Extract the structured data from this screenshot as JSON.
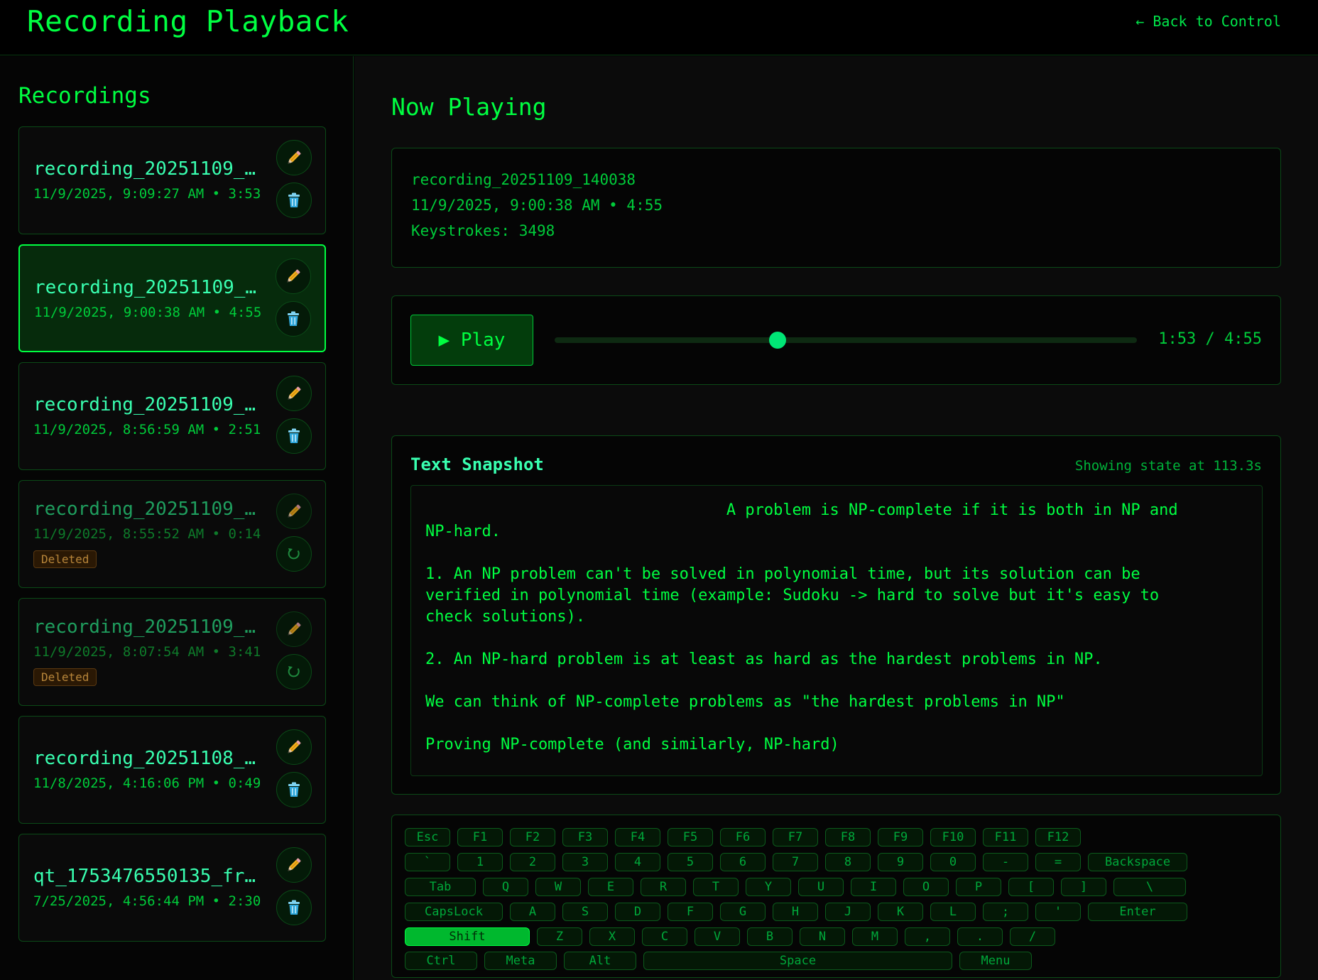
{
  "header": {
    "title": "Recording Playback",
    "back_label": "← Back to Control"
  },
  "sidebar": {
    "heading": "Recordings",
    "recordings": [
      {
        "name": "recording_20251109_…",
        "meta": "11/9/2025, 9:09:27 AM • 3:53",
        "state": "normal"
      },
      {
        "name": "recording_20251109_…",
        "meta": "11/9/2025, 9:00:38 AM • 4:55",
        "state": "active"
      },
      {
        "name": "recording_20251109_…",
        "meta": "11/9/2025, 8:56:59 AM • 2:51",
        "state": "normal"
      },
      {
        "name": "recording_20251109_…",
        "meta": "11/9/2025, 8:55:52 AM • 0:14",
        "state": "deleted",
        "badge": "Deleted"
      },
      {
        "name": "recording_20251109_…",
        "meta": "11/9/2025, 8:07:54 AM • 3:41",
        "state": "deleted",
        "badge": "Deleted"
      },
      {
        "name": "recording_20251108_…",
        "meta": "11/8/2025, 4:16:06 PM • 0:49",
        "state": "normal"
      },
      {
        "name": "qt_1753476550135_fr…",
        "meta": "7/25/2025, 4:56:44 PM • 2:30",
        "state": "normal"
      }
    ],
    "icons": {
      "edit": "pencil-icon",
      "delete": "trash-icon",
      "restore": "restore-icon"
    }
  },
  "main": {
    "heading": "Now Playing",
    "info": {
      "name": "recording_20251109_140038",
      "meta": "11/9/2025, 9:00:38 AM • 4:55",
      "keystrokes": "Keystrokes: 3498"
    },
    "player": {
      "play_label": "▶ Play",
      "time": "1:53 / 4:55",
      "progress": 0.383
    },
    "snapshot": {
      "title": "Text Snapshot",
      "state": "Showing state at 113.3s",
      "text": "                                A problem is NP-complete if it is both in NP and\nNP-hard.\n\n1. An NP problem can't be solved in polynomial time, but its solution can be\nverified in polynomial time (example: Sudoku -> hard to solve but it's easy to\ncheck solutions).\n\n2. An NP-hard problem is at least as hard as the hardest problems in NP.\n\nWe can think of NP-complete problems as \"the hardest problems in NP\"\n\nProving NP-complete (and similarly, NP-hard)"
    },
    "keyboard": {
      "pressed": "Shift",
      "rows": [
        [
          "Esc",
          "F1",
          "F2",
          "F3",
          "F4",
          "F5",
          "F6",
          "F7",
          "F8",
          "F9",
          "F10",
          "F11",
          "F12"
        ],
        [
          "`",
          "1",
          "2",
          "3",
          "4",
          "5",
          "6",
          "7",
          "8",
          "9",
          "0",
          "-",
          "=",
          "Backspace"
        ],
        [
          "Tab",
          "Q",
          "W",
          "E",
          "R",
          "T",
          "Y",
          "U",
          "I",
          "O",
          "P",
          "[",
          "]",
          "\\"
        ],
        [
          "CapsLock",
          "A",
          "S",
          "D",
          "F",
          "G",
          "H",
          "J",
          "K",
          "L",
          ";",
          "'",
          "Enter"
        ],
        [
          "Shift",
          "Z",
          "X",
          "C",
          "V",
          "B",
          "N",
          "M",
          ",",
          ".",
          "/"
        ],
        [
          "Ctrl",
          "Meta",
          "Alt",
          "Space",
          "Menu"
        ]
      ]
    }
  },
  "colors": {
    "accent": "#00ff41",
    "background": "#000000",
    "panel": "#050505",
    "active_card": "#062b0c",
    "deleted_badge": "#b8863a"
  }
}
